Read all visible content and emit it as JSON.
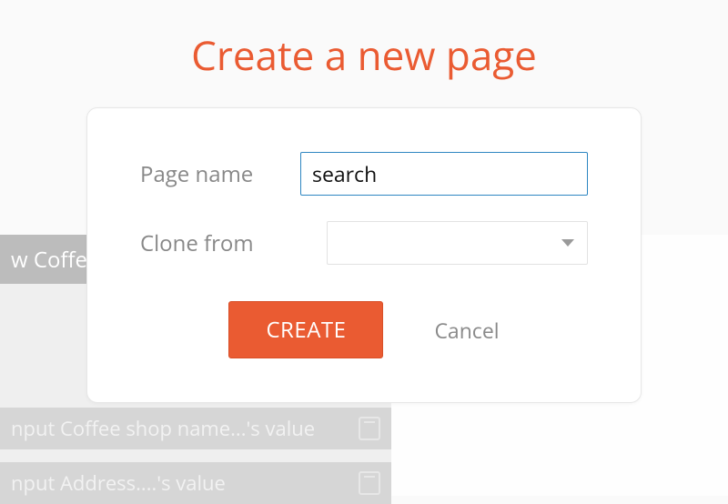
{
  "title": "Create a new page",
  "form": {
    "page_name": {
      "label": "Page name",
      "value": "search"
    },
    "clone_from": {
      "label": "Clone from",
      "value": ""
    }
  },
  "buttons": {
    "create": "CREATE",
    "cancel": "Cancel"
  },
  "background": {
    "header": "w Coffee",
    "row1": "nput Coffee shop name...'s value",
    "row2": "nput Address....'s value"
  }
}
